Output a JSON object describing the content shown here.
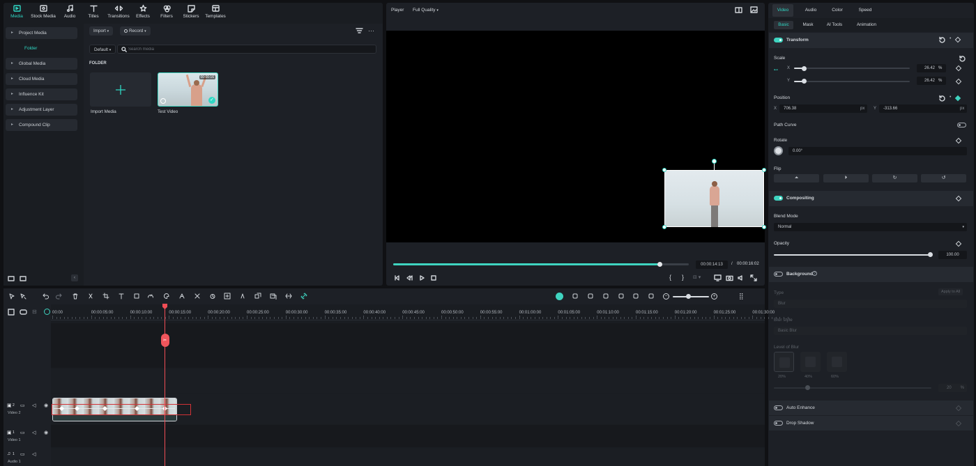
{
  "toolbar": {
    "tabs": [
      {
        "label": "Media",
        "icon": "media-icon",
        "active": true
      },
      {
        "label": "Stock Media",
        "icon": "stock-media-icon"
      },
      {
        "label": "Audio",
        "icon": "music-note-icon"
      },
      {
        "label": "Titles",
        "icon": "titles-icon"
      },
      {
        "label": "Transitions",
        "icon": "transitions-icon"
      },
      {
        "label": "Effects",
        "icon": "effects-icon"
      },
      {
        "label": "Filters",
        "icon": "filters-icon"
      },
      {
        "label": "Stickers",
        "icon": "stickers-icon"
      },
      {
        "label": "Templates",
        "icon": "templates-icon"
      }
    ]
  },
  "sidebar": {
    "items": [
      {
        "label": "Project Media"
      },
      {
        "label": "Folder"
      },
      {
        "label": "Global Media"
      },
      {
        "label": "Cloud Media"
      },
      {
        "label": "Influence Kit"
      },
      {
        "label": "Adjustment Layer"
      },
      {
        "label": "Compound Clip"
      }
    ]
  },
  "media": {
    "import_label": "Import",
    "record_label": "Record",
    "sort_label": "Default",
    "search_placeholder": "Search media",
    "section_label": "FOLDER",
    "import_tile_label": "Import Media",
    "clip_label": "Test Video",
    "clip_duration": "00:00:16"
  },
  "player": {
    "label": "Player",
    "quality": "Full Quality",
    "current_time": "00:00:14:13",
    "separator": "/",
    "total_time": "00:00:16:02",
    "progress": 0.9
  },
  "inspector": {
    "tabs": [
      "Video",
      "Audio",
      "Color",
      "Speed"
    ],
    "subtabs": [
      "Basic",
      "Mask",
      "AI Tools",
      "Animation"
    ],
    "transform": {
      "title": "Transform",
      "scale_label": "Scale",
      "x_label": "X",
      "y_label": "Y",
      "scale_x": "26.42",
      "scale_y": "26.42",
      "unit": "%",
      "position_label": "Position",
      "pos_x": "706.38",
      "pos_y": "-313.66",
      "px": "px",
      "path_curve": "Path Curve",
      "rotate_label": "Rotate",
      "rotate_value": "0.00°",
      "flip_label": "Flip"
    },
    "compositing": {
      "title": "Compositing",
      "blend_label": "Blend Mode",
      "blend_value": "Normal",
      "opacity_label": "Opacity",
      "opacity_value": "100.00"
    },
    "background": {
      "title": "Background",
      "type_label": "Type",
      "apply_all": "Apply to All",
      "type_value": "Blur",
      "blur_style_label": "Blur style",
      "blur_style_value": "Basic Blur",
      "level_label": "Level of Blur",
      "levels": [
        "20%",
        "40%",
        "60%"
      ],
      "level_value": "20",
      "unit": "%"
    },
    "auto_enhance": "Auto Enhance",
    "drop_shadow": "Drop Shadow"
  },
  "timeline": {
    "ruler": [
      "00:00",
      "00:00:05:00",
      "00:00:10:00",
      "00:00:15:00",
      "00:00:20:00",
      "00:00:25:00",
      "00:00:30:00",
      "00:00:35:00",
      "00:00:40:00",
      "00:00:45:00",
      "00:00:50:00",
      "00:00:55:00",
      "00:01:00:00",
      "00:01:05:00",
      "00:01:10:00",
      "00:01:15:00",
      "00:01:20:00",
      "00:01:25:00",
      "00:01:30:00"
    ],
    "tracks": [
      {
        "label": "Video 2",
        "num": "2"
      },
      {
        "label": "Video 1",
        "num": "1"
      },
      {
        "label": "Audio 1",
        "num": "1"
      }
    ]
  }
}
